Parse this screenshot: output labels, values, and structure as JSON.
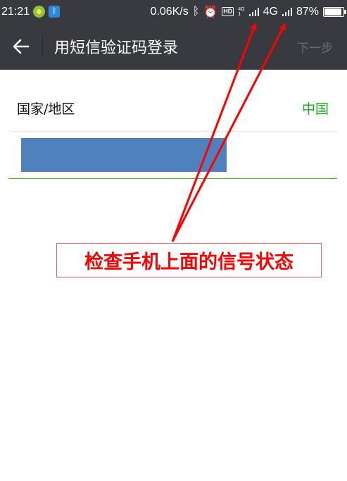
{
  "status_bar": {
    "time": "21:21",
    "speed": "0.06K/s",
    "bt_symbol": "ᛒ",
    "alarm_symbol": "⏰",
    "hd": "HD",
    "net_small_top": "4G",
    "net_small_bottom": "1",
    "net": "4G",
    "battery": "87%"
  },
  "header": {
    "back_symbol": "←",
    "title": "用短信验证码登录",
    "next_label": "下一步"
  },
  "form": {
    "country_label": "国家/地区",
    "country_value": "中国"
  },
  "annotation": {
    "text": "检查手机上面的信号状态"
  },
  "colors": {
    "bar_bg": "#393a3f",
    "accent_green": "#1aad19",
    "redaction_blue": "#4f81bd",
    "annotation_red": "#ff0000"
  }
}
